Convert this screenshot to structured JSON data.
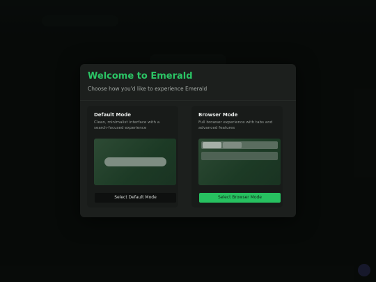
{
  "modal": {
    "title": "Welcome to Emerald",
    "subtitle": "Choose how you'd like to experience Emerald"
  },
  "cards": {
    "default": {
      "title": "Default Mode",
      "description": "Clean, minimalist interface with a search-focused experience",
      "button_label": "Select Default Mode"
    },
    "browser": {
      "title": "Browser Mode",
      "description": "Full browser experience with tabs and advanced features",
      "button_label": "Select Browser Mode"
    }
  },
  "colors": {
    "accent": "#2bc465",
    "button_primary": "#27c160",
    "modal_bg": "#1c1f1d",
    "card_bg": "#181b19"
  }
}
